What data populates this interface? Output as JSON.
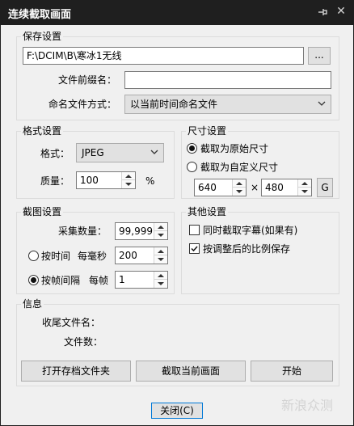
{
  "window": {
    "title": "连续截取画面"
  },
  "save": {
    "group_label": "保存设置",
    "path_value": "F:\\DCIM\\B\\寒冰1无线",
    "browse_label": "...",
    "prefix_label": "文件前缀名：",
    "prefix_value": "",
    "naming_label": "命名文件方式：",
    "naming_value": "以当前时间命名文件"
  },
  "format": {
    "group_label": "格式设置",
    "format_label": "格式：",
    "format_value": "JPEG",
    "quality_label": "质量：",
    "quality_value": "100",
    "quality_unit": "%"
  },
  "size": {
    "group_label": "尺寸设置",
    "original_label": "截取为原始尺寸",
    "custom_label": "截取为自定义尺寸",
    "width_value": "640",
    "times": "×",
    "height_value": "480",
    "g_label": "G"
  },
  "capture": {
    "group_label": "截图设置",
    "count_label": "采集数量：",
    "count_value": "99,999",
    "by_time_label": "按时间",
    "per_ms_label": "每毫秒",
    "ms_value": "200",
    "by_frame_label": "按帧间隔",
    "per_frame_label": "每帧",
    "frame_value": "1"
  },
  "other": {
    "group_label": "其他设置",
    "subtitle_label": "同时截取字幕(如果有)",
    "ratio_label": "按调整后的比例保存"
  },
  "info": {
    "group_label": "信息",
    "last_file_label": "收尾文件名：",
    "file_count_label": "文件数："
  },
  "buttons": {
    "open_folder": "打开存档文件夹",
    "capture_current": "截取当前画面",
    "start": "开始",
    "close": "关闭(C)"
  },
  "watermark": "新浪众测"
}
